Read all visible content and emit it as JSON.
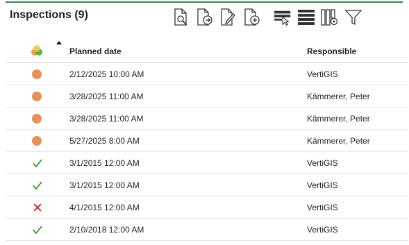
{
  "panel": {
    "title": "Inspections (9)"
  },
  "toolbar": {
    "buttons": [
      {
        "name": "view-document-icon"
      },
      {
        "name": "export-document-icon"
      },
      {
        "name": "edit-document-icon"
      },
      {
        "name": "add-document-icon"
      },
      {
        "name": "select-rows-icon"
      },
      {
        "name": "list-view-icon"
      },
      {
        "name": "column-settings-icon"
      },
      {
        "name": "filter-icon"
      }
    ]
  },
  "table": {
    "columns": {
      "date": "Planned date",
      "responsible": "Responsible"
    },
    "sort": {
      "column": "status",
      "direction": "ascending"
    },
    "rows": [
      {
        "status": "planned",
        "date": "2/12/2025 10:00 AM",
        "responsible": "VertiGIS"
      },
      {
        "status": "planned",
        "date": "3/28/2025 11:00 AM",
        "responsible": "Kämmerer, Peter"
      },
      {
        "status": "planned",
        "date": "3/28/2025 11:00 AM",
        "responsible": "Kämmerer, Peter"
      },
      {
        "status": "planned",
        "date": "5/27/2025 8:00 AM",
        "responsible": "Kämmerer, Peter"
      },
      {
        "status": "passed",
        "date": "3/1/2015 12:00 AM",
        "responsible": "VertiGIS"
      },
      {
        "status": "passed",
        "date": "3/1/2015 12:00 AM",
        "responsible": "VertiGIS"
      },
      {
        "status": "failed",
        "date": "4/1/2015 12:00 AM",
        "responsible": "VertiGIS"
      },
      {
        "status": "passed",
        "date": "2/10/2018 12:00 AM",
        "responsible": "VertiGIS"
      }
    ]
  },
  "colors": {
    "accent_rule": "#2f8a4a",
    "planned": "#e8905a",
    "passed": "#2a9a2a",
    "failed": "#c0281e"
  }
}
